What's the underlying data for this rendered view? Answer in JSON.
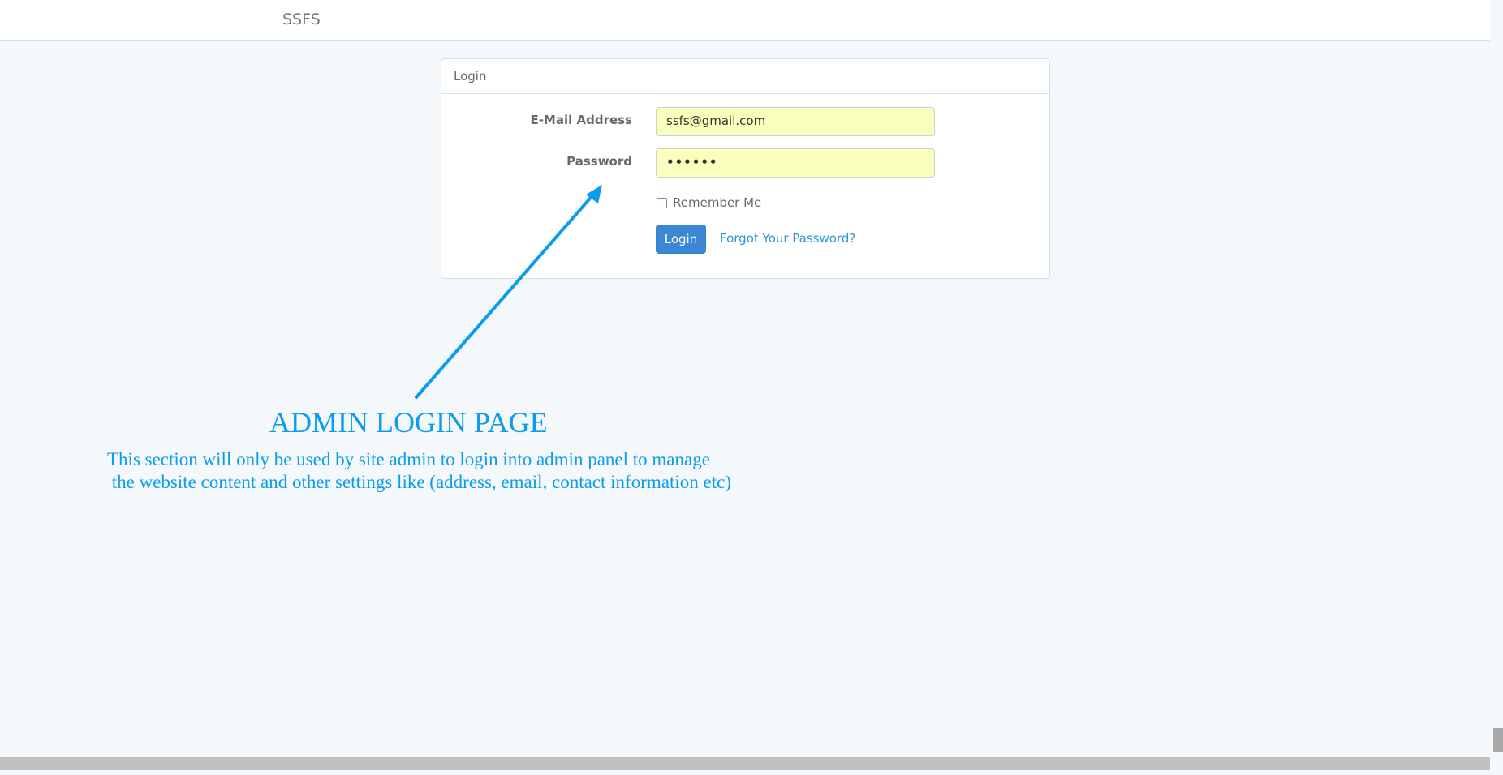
{
  "navbar": {
    "brand": "SSFS"
  },
  "login_panel": {
    "heading": "Login",
    "email_label": "E-Mail Address",
    "email_value": "ssfs@gmail.com",
    "password_label": "Password",
    "password_value": "••••••",
    "remember_label": "Remember Me",
    "login_button": "Login",
    "forgot_link": "Forgot Your Password?"
  },
  "annotation": {
    "title": "ADMIN LOGIN PAGE",
    "description": "This section will only be used by site admin to login into admin panel to manage\n the website content and other settings like (address, email, contact information etc)",
    "color": "#0a9ded"
  },
  "colors": {
    "background": "#f5f8fa",
    "button": "#3c86d6",
    "autofill": "#faffbd",
    "link": "#3097d1"
  }
}
